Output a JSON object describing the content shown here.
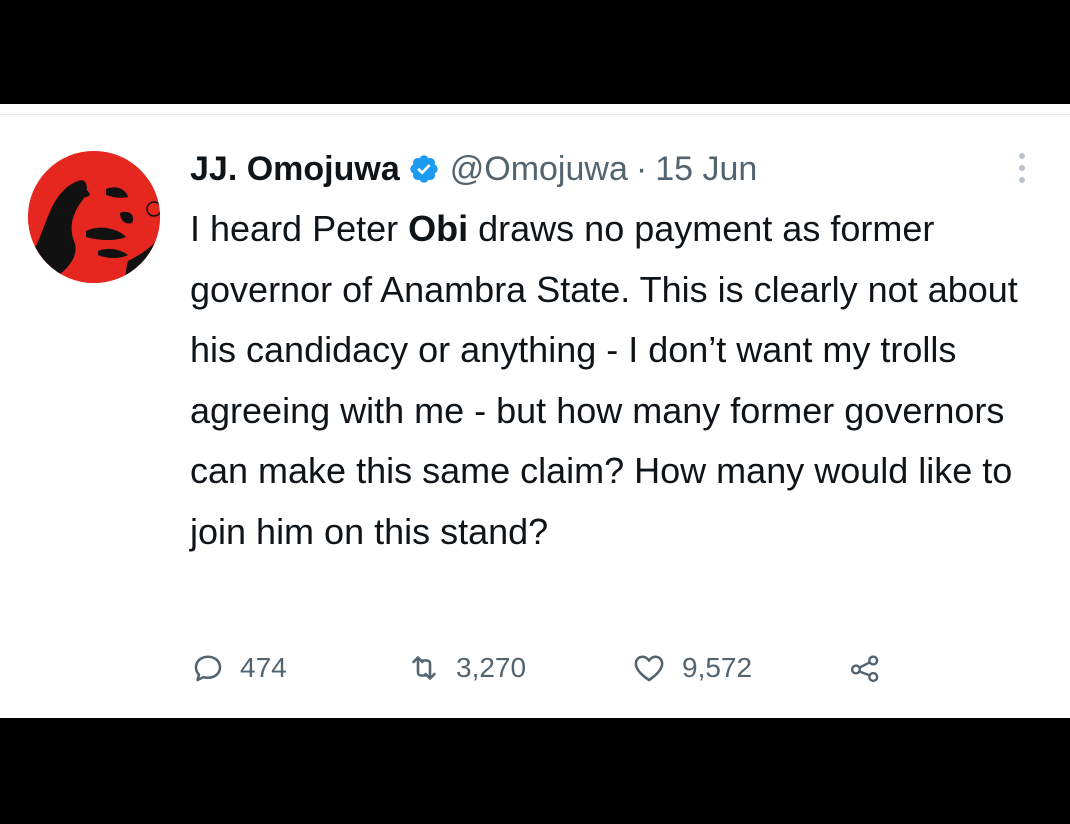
{
  "tweet": {
    "author_name": "JJ. Omojuwa",
    "handle": "@Omojuwa",
    "separator": "·",
    "date": "15 Jun",
    "text_parts": [
      {
        "text": "I heard Peter ",
        "bold": false
      },
      {
        "text": "Obi",
        "bold": true
      },
      {
        "text": " draws no payment as former governor of Anambra State. This is clearly not about his candidacy or anything - I don’t want my trolls agreeing with me - but how many former governors can make this same claim? How many would like to join him on this stand?",
        "bold": false
      }
    ]
  },
  "actions": {
    "replies": "474",
    "retweets": "3,270",
    "likes": "9,572"
  },
  "icons": {
    "verified": "verified-badge-icon",
    "more": "more-vertical-icon",
    "reply": "reply-icon",
    "retweet": "retweet-icon",
    "like": "heart-icon",
    "share": "share-icon"
  },
  "colors": {
    "background": "#000000",
    "card": "#ffffff",
    "text": "#0f1419",
    "secondary": "#536471",
    "verified": "#1d9bf0",
    "avatar": "#e5271f"
  }
}
